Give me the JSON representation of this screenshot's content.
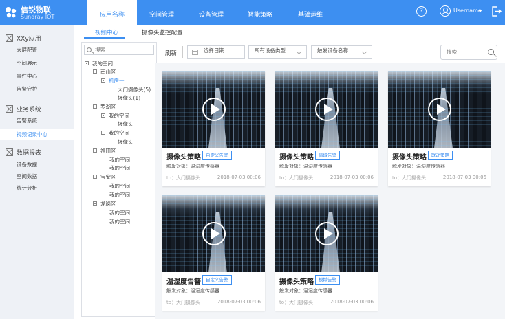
{
  "colors": {
    "brand": "#3d8ff1",
    "sidebar_bg": "#eef1f6"
  },
  "logo": {
    "name_cn": "信锐物联",
    "name_en": "Sundray IOT",
    "icon": "sundray-logo-icon"
  },
  "nav": {
    "tabs": [
      {
        "label": "应用名称",
        "active": true
      },
      {
        "label": "空间管理",
        "active": false
      },
      {
        "label": "设备管理",
        "active": false
      },
      {
        "label": "智能策略",
        "active": false
      },
      {
        "label": "基础运维",
        "active": false
      }
    ],
    "help_label": "?",
    "username": "Username"
  },
  "sidebar": {
    "groups": [
      {
        "title": "XXy应用",
        "icon": "box-icon",
        "items": [
          "大屏配置",
          "空间展示",
          "事件中心",
          "告警守护"
        ]
      },
      {
        "title": "业务系统",
        "icon": "box-icon",
        "items": [
          "告警系统",
          "视频记录中心"
        ]
      },
      {
        "title": "数据报表",
        "icon": "box-icon",
        "items": [
          "设备数据",
          "空间数据",
          "统计分析"
        ]
      }
    ],
    "active_item": "视频记录中心"
  },
  "subtabs": [
    {
      "label": "视频中心",
      "active": true
    },
    {
      "label": "摄像头监控配置",
      "active": false
    }
  ],
  "tree": {
    "search_placeholder": "搜索",
    "nodes": [
      {
        "label": "我的空间",
        "expandable": true
      },
      {
        "label": "南山区",
        "expandable": true
      },
      {
        "label": "机房一",
        "expandable": true,
        "selected": true
      },
      {
        "label": "大门摄像头(5)"
      },
      {
        "label": "摄像头(1)"
      },
      {
        "label": "罗湖区",
        "expandable": true
      },
      {
        "label": "我的空间",
        "expandable": true
      },
      {
        "label": "摄像头"
      },
      {
        "label": "我的空间",
        "expandable": true
      },
      {
        "label": "摄像头"
      },
      {
        "label": "福田区",
        "expandable": true
      },
      {
        "label": "我的空间"
      },
      {
        "label": "我的空间"
      },
      {
        "label": "宝安区",
        "expandable": true
      },
      {
        "label": "我的空间"
      },
      {
        "label": "我的空间"
      },
      {
        "label": "龙岗区",
        "expandable": true
      },
      {
        "label": "我的空间"
      },
      {
        "label": "我的空间"
      }
    ]
  },
  "toolbar": {
    "refresh_label": "刷新",
    "date_placeholder": "选择日期",
    "device_type": "所有设备类型",
    "device_name": "触发设备名称",
    "search_placeholder": "搜索"
  },
  "cards": [
    {
      "title": "摄像头策略",
      "tag": "自定义告警",
      "object": "触发对象：温湿度传感器",
      "to": "to：大门摄像头",
      "time": "2018-07-03 00:06"
    },
    {
      "title": "摄像头策略",
      "tag": "值域告警",
      "object": "触发对象：温湿度传感器",
      "to": "to：大门摄像头",
      "time": "2018-07-03 00:06"
    },
    {
      "title": "摄像头策略",
      "tag": "联动策略",
      "object": "触发对象：温湿度传感器",
      "to": "to：大门摄像头",
      "time": "2018-07-03 00:06"
    },
    {
      "title": "温湿度告警",
      "tag": "自定义告警",
      "object": "触发对象：温湿度传感器",
      "to": "to：大门摄像头",
      "time": "2018-07-03 00:06"
    },
    {
      "title": "摄像头策略",
      "tag": "模糊告警",
      "object": "触发对象：温湿度传感器",
      "to": "to：大门摄像头",
      "time": "2018-07-03 00:06"
    }
  ]
}
